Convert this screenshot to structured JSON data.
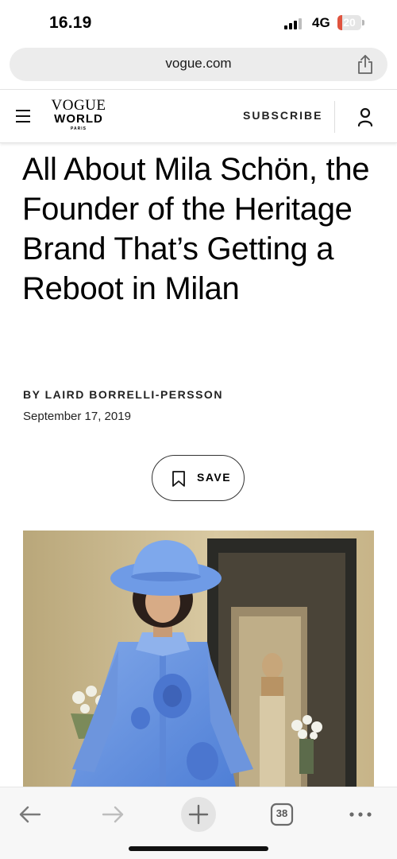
{
  "status_bar": {
    "time": "16.19",
    "network": "4G",
    "battery": "20",
    "battery_level": 0.2
  },
  "browser": {
    "url": "vogue.com",
    "tab_count": "38"
  },
  "site_header": {
    "logo_line1": "VOGUE",
    "logo_line2": "WORLD",
    "logo_line3": "PARIS",
    "subscribe_label": "SUBSCRIBE"
  },
  "article": {
    "headline": "All About Mila Schön, the Founder of the Heritage Brand That’s Getting a Reboot in Milan",
    "byline": "BY LAIRD BORRELLI-PERSSON",
    "date": "September 17, 2019",
    "save_label": "SAVE"
  },
  "icons": {
    "menu": "hamburger-icon",
    "share": "share-icon",
    "account": "user-icon",
    "bookmark": "bookmark-icon",
    "back": "arrow-left-icon",
    "forward": "arrow-right-icon",
    "new_tab": "plus-icon",
    "tabs": "tabs-icon",
    "more": "more-icon"
  },
  "colors": {
    "battery_low": "#e0533e",
    "url_bar": "#ececec",
    "toolbar": "#f7f7f7"
  }
}
